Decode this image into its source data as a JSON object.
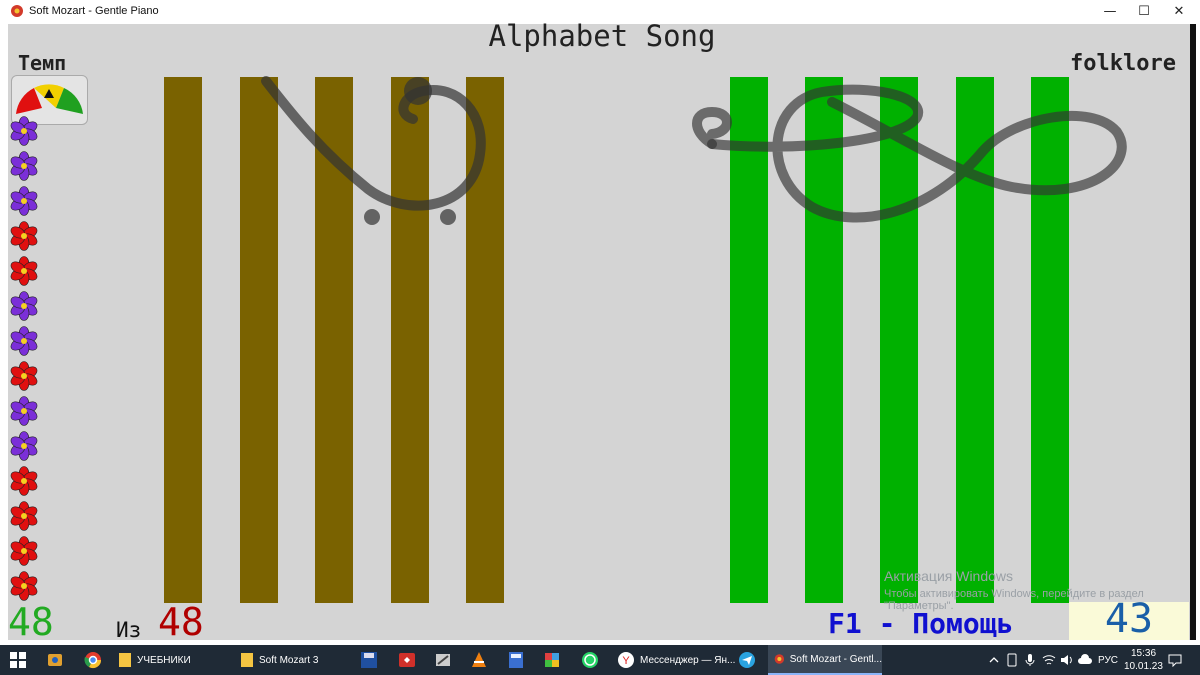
{
  "window": {
    "title": "Soft Mozart - Gentle Piano",
    "controls": [
      "minimize-icon",
      "maximize-icon",
      "close-icon"
    ]
  },
  "game": {
    "song_title": "Alphabet Song",
    "tempo_label": "Темп",
    "genre": "folklore",
    "played_count": "48",
    "of_label": "Из",
    "total_count": "48",
    "help_hint": "F1 - Помощь",
    "score": "43"
  },
  "flowers": [
    "purple",
    "purple",
    "purple",
    "red",
    "red",
    "purple",
    "purple",
    "red",
    "purple",
    "purple",
    "red",
    "red",
    "red",
    "red"
  ],
  "colors": {
    "left_bars": "#7a6200",
    "right_bars": "#00b100",
    "canvas": "#d4d4d4",
    "flower_purple": "#7b2fd8",
    "flower_red": "#e01010"
  },
  "activation": {
    "line1": "Активация Windows",
    "line2": "Чтобы активировать Windows, перейдите в раздел",
    "line3": "\"Параметры\"."
  },
  "taskbar": {
    "items": [
      {
        "name": "explorer-icon",
        "label": ""
      },
      {
        "name": "chrome-icon",
        "label": ""
      },
      {
        "name": "folder-icon",
        "label": "УЧЕБНИКИ"
      },
      {
        "name": "folder-icon-2",
        "label": "Soft Mozart 3"
      },
      {
        "name": "save-icon",
        "label": ""
      },
      {
        "name": "anydesk-icon",
        "label": ""
      },
      {
        "name": "paint-icon",
        "label": ""
      },
      {
        "name": "vlc-icon",
        "label": ""
      },
      {
        "name": "calculator-icon",
        "label": ""
      },
      {
        "name": "puzzle-icon",
        "label": ""
      },
      {
        "name": "whatsapp-icon",
        "label": ""
      },
      {
        "name": "yandex-icon",
        "label": "Мессенджер — Ян..."
      },
      {
        "name": "telegram-icon",
        "label": ""
      },
      {
        "name": "soft-mozart-icon",
        "label": "Soft Mozart - Gentl..."
      }
    ],
    "tray": {
      "language": "РУС",
      "time": "15:36",
      "date": "10.01.23"
    }
  }
}
